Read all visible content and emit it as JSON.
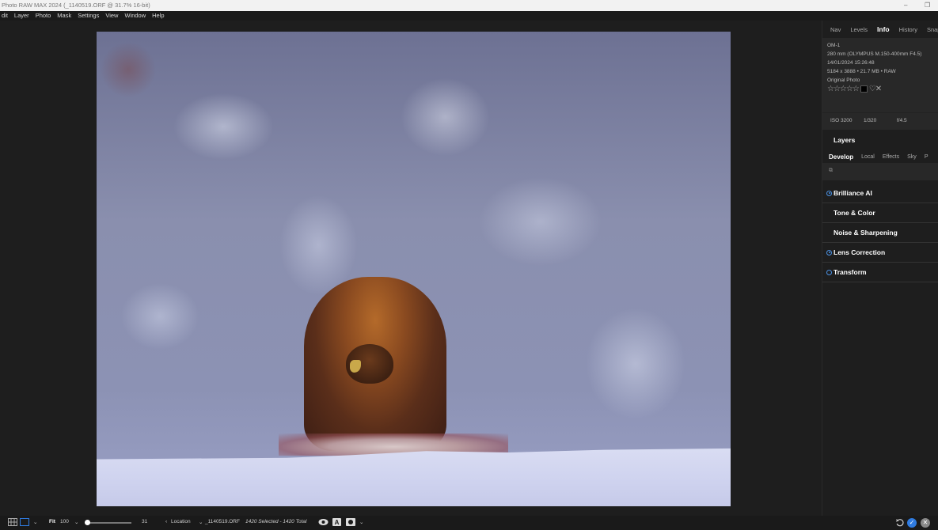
{
  "window": {
    "title": "Photo RAW MAX 2024 (_1140519.ORF @ 31.7% 16-bit)",
    "minimize": "–",
    "restore": "❐"
  },
  "menu": [
    "dit",
    "Layer",
    "Photo",
    "Mask",
    "Settings",
    "View",
    "Window",
    "Help"
  ],
  "panel": {
    "tabs": [
      "Nav",
      "Levels",
      "Info",
      "History",
      "Snap"
    ],
    "active_tab": "Info",
    "info": {
      "camera": "OM-1",
      "lens": "280 mm (OLYMPUS M.150-400mm F4.5)",
      "datetime": "14/01/2024 15:26:48",
      "dimensions": "5184 x 3888 • 21.7 MB • RAW",
      "status": "Original Photo",
      "stars": "☆☆☆☆☆",
      "heart": "♡",
      "reject": "✕"
    },
    "exif": {
      "iso": "ISO 3200",
      "shutter": "1/320",
      "aperture": "f/4.5"
    },
    "layers_title": "Layers",
    "develop_tabs": [
      "Develop",
      "Local",
      "Effects",
      "Sky",
      "P"
    ],
    "develop_sub_icon": "⧉",
    "sections": [
      {
        "label": "Brilliance AI",
        "indicator": "filled"
      },
      {
        "label": "Tone & Color",
        "indicator": "none"
      },
      {
        "label": "Noise & Sharpening",
        "indicator": "none"
      },
      {
        "label": "Lens Correction",
        "indicator": "filled"
      },
      {
        "label": "Transform",
        "indicator": "empty"
      }
    ]
  },
  "bottom": {
    "fit": "Fit",
    "zoom": "100",
    "slider_value": "31",
    "location": "Location",
    "filename": "_1140519.ORF",
    "selection": "1420 Selected - 1420 Total",
    "accent": "#2f7be0"
  }
}
